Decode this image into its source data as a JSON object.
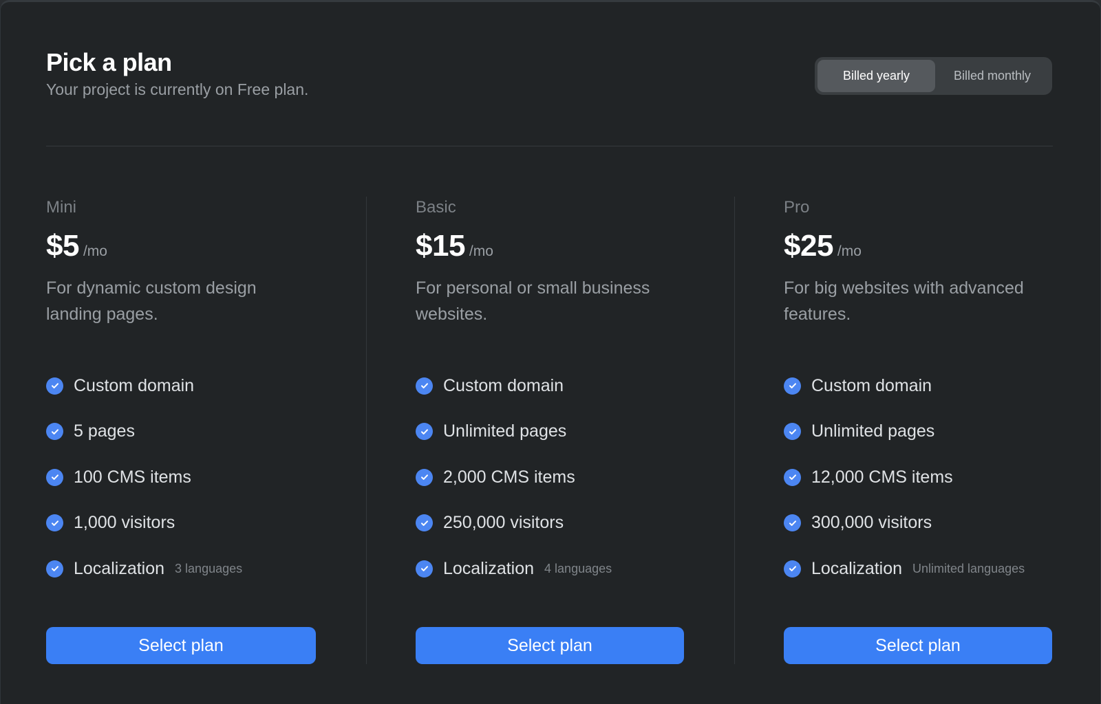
{
  "header": {
    "title": "Pick a plan",
    "subtitle": "Your project is currently on Free plan."
  },
  "billing_toggle": {
    "options": [
      {
        "label": "Billed yearly",
        "selected": true
      },
      {
        "label": "Billed monthly",
        "selected": false
      }
    ]
  },
  "colors": {
    "accent": "#3a7ff5",
    "check": "#4c86f2",
    "background": "#212426"
  },
  "plans": [
    {
      "name": "Mini",
      "price": "$5",
      "per": "/mo",
      "description": "For dynamic custom design landing pages.",
      "features": [
        {
          "label": "Custom domain",
          "note": ""
        },
        {
          "label": "5 pages",
          "note": ""
        },
        {
          "label": "100 CMS items",
          "note": ""
        },
        {
          "label": "1,000 visitors",
          "note": ""
        },
        {
          "label": "Localization",
          "note": "3 languages"
        }
      ],
      "button": "Select plan"
    },
    {
      "name": "Basic",
      "price": "$15",
      "per": "/mo",
      "description": "For personal or small business websites.",
      "features": [
        {
          "label": "Custom domain",
          "note": ""
        },
        {
          "label": "Unlimited pages",
          "note": ""
        },
        {
          "label": "2,000 CMS items",
          "note": ""
        },
        {
          "label": "250,000 visitors",
          "note": ""
        },
        {
          "label": "Localization",
          "note": "4 languages"
        }
      ],
      "button": "Select plan"
    },
    {
      "name": "Pro",
      "price": "$25",
      "per": "/mo",
      "description": "For big websites with advanced features.",
      "features": [
        {
          "label": "Custom domain",
          "note": ""
        },
        {
          "label": "Unlimited pages",
          "note": ""
        },
        {
          "label": "12,000 CMS items",
          "note": ""
        },
        {
          "label": "300,000 visitors",
          "note": ""
        },
        {
          "label": "Localization",
          "note": "Unlimited languages"
        }
      ],
      "button": "Select plan"
    }
  ]
}
